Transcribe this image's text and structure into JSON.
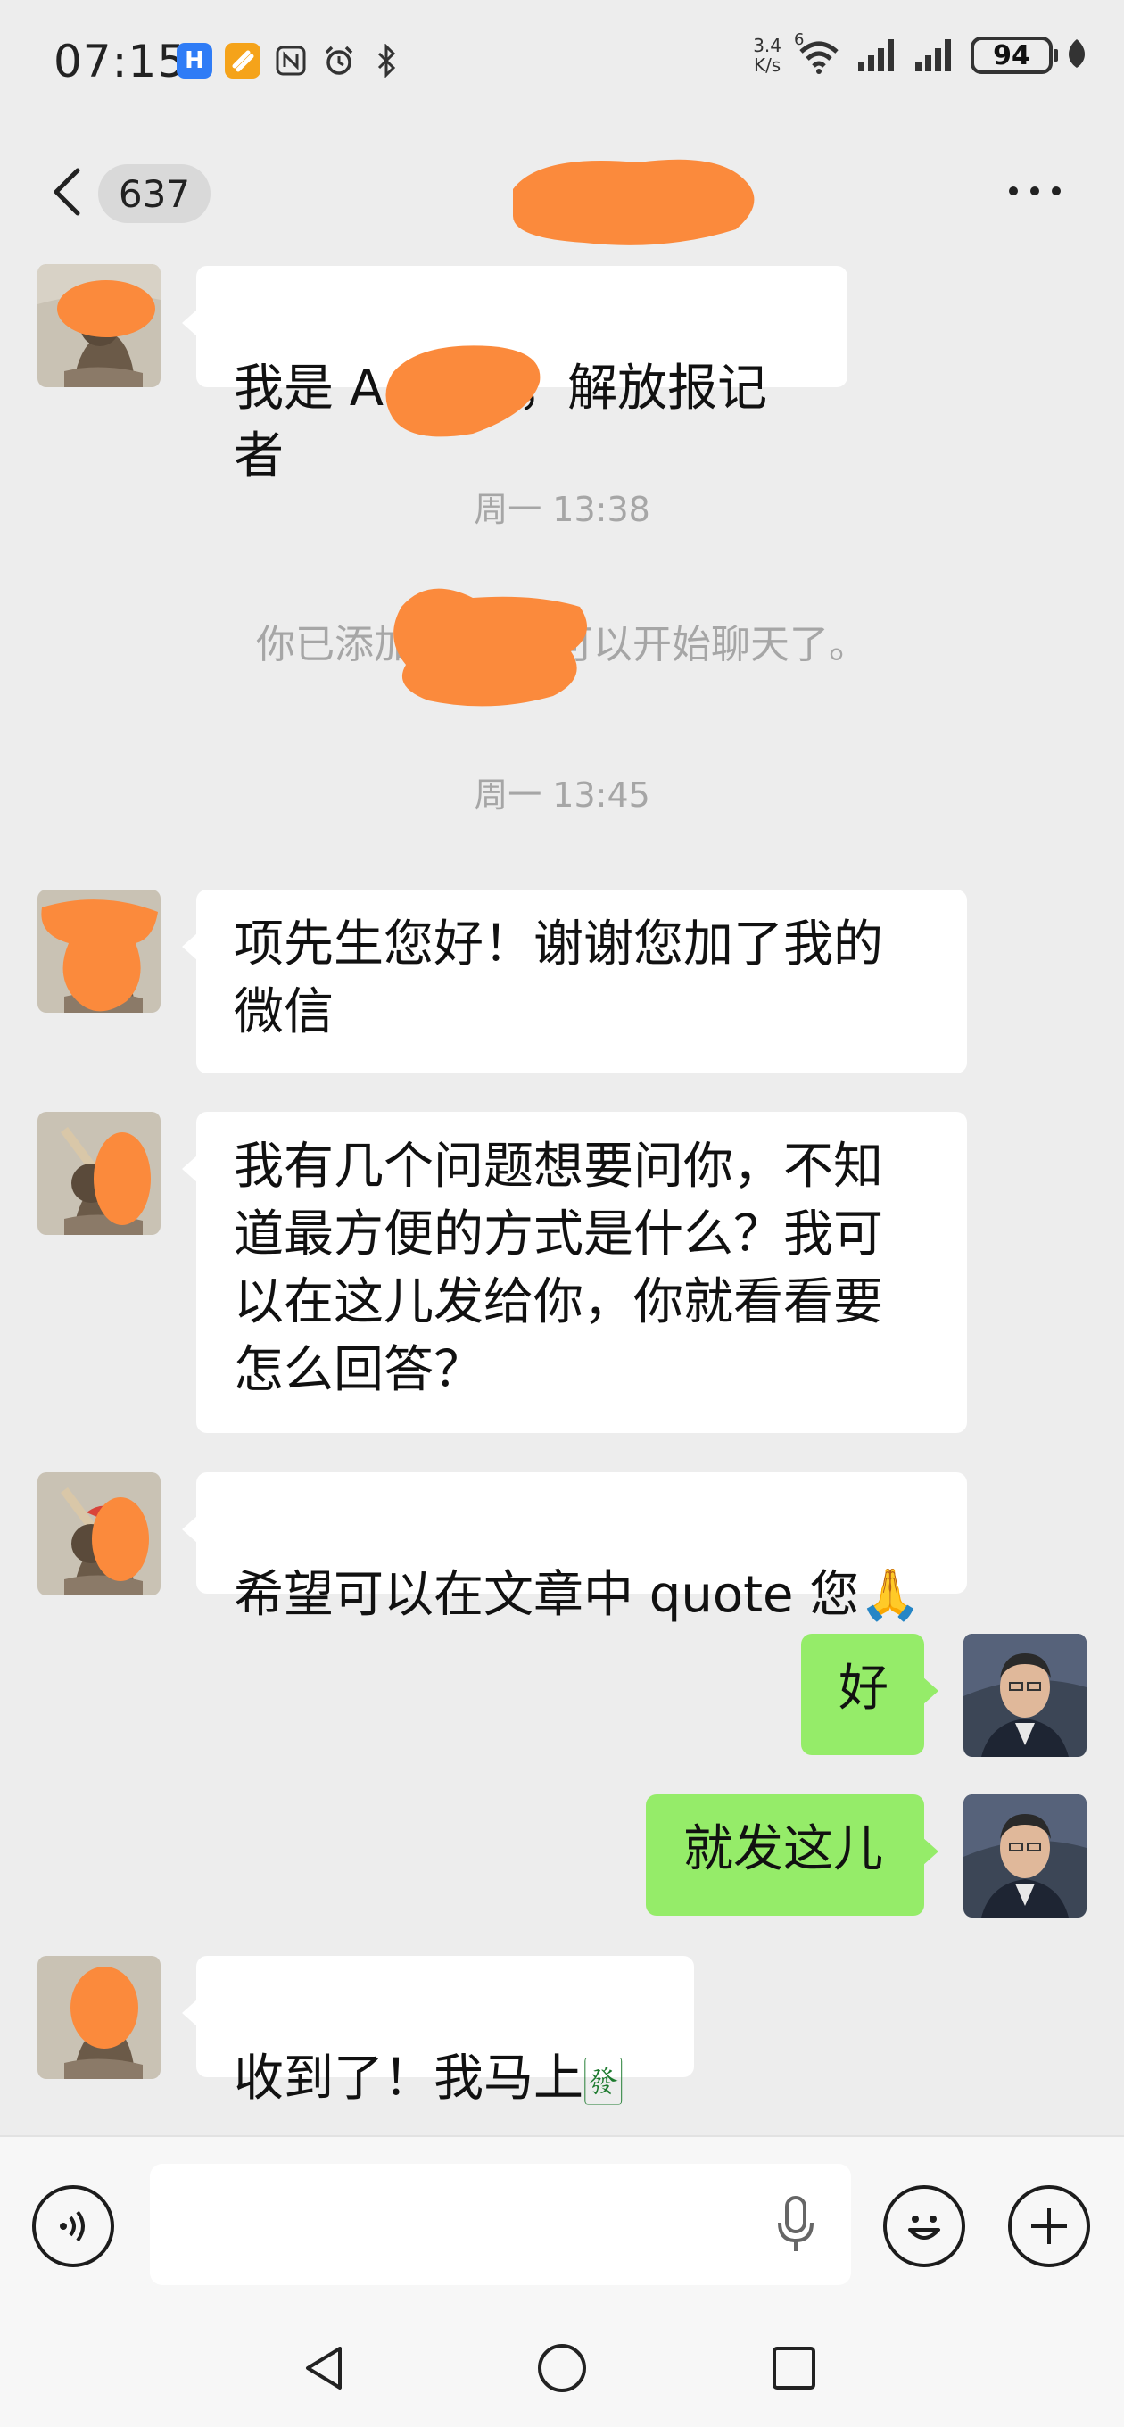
{
  "status_bar": {
    "time": "07:15",
    "app_icons": [
      "huawei-health-icon",
      "orange-app-icon",
      "nfc-icon",
      "alarm-icon",
      "bluetooth-icon"
    ],
    "net_speed_value": "3.4",
    "net_speed_unit": "K/s",
    "wifi_label": "6",
    "battery": "94"
  },
  "header": {
    "unread_count": "637"
  },
  "messages": [
    {
      "side": "in",
      "text_before": "我是 A",
      "text_after": "，解放报记者"
    },
    {
      "type": "time",
      "text": "周一 13:38"
    },
    {
      "type": "system",
      "text_before": "你已添加了",
      "text_after": "在可以开始聊天了。"
    },
    {
      "type": "time",
      "text": "周一 13:45"
    },
    {
      "side": "in",
      "text": "项先生您好！谢谢您加了我的\n微信"
    },
    {
      "side": "in",
      "text": "我有几个问题想要问你，不知\n道最方便的方式是什么？我可\n以在这儿发给你，你就看看要\n怎么回答？"
    },
    {
      "side": "in",
      "text": "希望可以在文章中 quote 您",
      "emoji": "🙏"
    },
    {
      "side": "out",
      "text": "好"
    },
    {
      "side": "out",
      "text": "就发这儿"
    },
    {
      "side": "in",
      "text": "收到了！我马上",
      "emoji": "🀅"
    }
  ],
  "colors": {
    "background": "#ededed",
    "incoming_bubble": "#ffffff",
    "outgoing_bubble": "#95ec69",
    "redaction": "#fb8a3c",
    "timestamp_text": "#a6a6a6"
  },
  "input_bar": {
    "voice_icon": "voice-input-icon",
    "mic_icon": "microphone-icon",
    "emoji_icon": "emoji-icon",
    "plus_icon": "plus-icon"
  },
  "nav_bar": {
    "back_icon": "triangle-back-icon",
    "home_icon": "circle-home-icon",
    "recents_icon": "square-recents-icon"
  }
}
